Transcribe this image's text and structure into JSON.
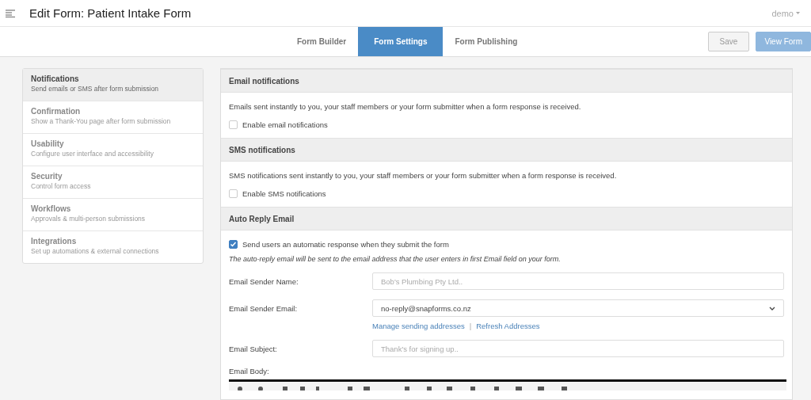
{
  "header": {
    "title": "Edit Form: Patient Intake Form",
    "user": "demo"
  },
  "tabs": [
    {
      "label": "Form Builder",
      "selected": false
    },
    {
      "label": "Form Settings",
      "selected": true
    },
    {
      "label": "Form Publishing",
      "selected": false
    }
  ],
  "actions": [
    {
      "label": "Save",
      "kind": "default"
    },
    {
      "label": "View Form",
      "kind": "primary"
    }
  ],
  "sidebar": {
    "items": [
      {
        "title": "Notifications",
        "subtitle": "Send emails or SMS after form submission",
        "selected": true
      },
      {
        "title": "Confirmation",
        "subtitle": "Show a Thank-You page after form submission",
        "selected": false
      },
      {
        "title": "Usability",
        "subtitle": "Configure user interface and accessibility",
        "selected": false
      },
      {
        "title": "Security",
        "subtitle": "Control form access",
        "selected": false
      },
      {
        "title": "Workflows",
        "subtitle": "Approvals & multi-person submissions",
        "selected": false
      },
      {
        "title": "Integrations",
        "subtitle": "Set up automations & external connections",
        "selected": false
      }
    ]
  },
  "sections": [
    {
      "title": "Email notifications",
      "description": "Emails sent instantly to you, your staff members or your form submitter when a form response is received.",
      "checkbox": {
        "label": "Enable email notifications",
        "checked": false
      }
    },
    {
      "title": "SMS notifications",
      "description": "SMS notifications sent instantly to you, your staff members or your form submitter when a form response is received.",
      "checkbox": {
        "label": "Enable SMS notifications",
        "checked": false
      }
    },
    {
      "title": "Auto Reply Email",
      "checkbox": {
        "label": "Send users an automatic response when they submit the form",
        "checked": true
      },
      "note": "The auto-reply email will be sent to the email address that the user enters in first Email field on your form.",
      "fields": [
        {
          "label": "Email Sender Name:",
          "kind": "text",
          "placeholder": "Bob's Plumbing Pty Ltd.."
        },
        {
          "label": "Email Sender Email:",
          "kind": "select",
          "value": "no-reply@snapforms.co.nz",
          "links": [
            "Manage sending addresses",
            "Refresh Addresses"
          ],
          "link_separator": "|"
        },
        {
          "label": "Email Subject:",
          "kind": "text",
          "placeholder": "Thank's for signing up.."
        },
        {
          "label": "Email Body:",
          "kind": "editor"
        }
      ]
    }
  ]
}
